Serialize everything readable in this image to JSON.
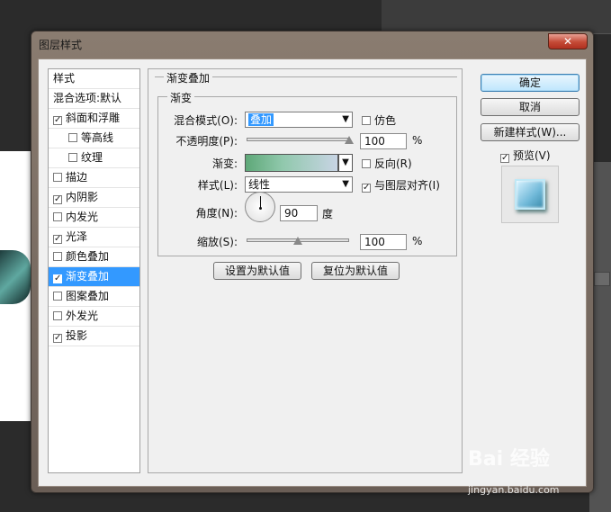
{
  "window": {
    "title": "图层样式",
    "close_symbol": "✕"
  },
  "style_list": {
    "items": [
      {
        "label": "样式",
        "checkbox": false,
        "checked": false,
        "indent": false,
        "selected": false
      },
      {
        "label": "混合选项:默认",
        "checkbox": false,
        "checked": false,
        "indent": false,
        "selected": false
      },
      {
        "label": "斜面和浮雕",
        "checkbox": true,
        "checked": true,
        "indent": false,
        "selected": false
      },
      {
        "label": "等高线",
        "checkbox": true,
        "checked": false,
        "indent": true,
        "selected": false
      },
      {
        "label": "纹理",
        "checkbox": true,
        "checked": false,
        "indent": true,
        "selected": false
      },
      {
        "label": "描边",
        "checkbox": true,
        "checked": false,
        "indent": false,
        "selected": false
      },
      {
        "label": "内阴影",
        "checkbox": true,
        "checked": true,
        "indent": false,
        "selected": false
      },
      {
        "label": "内发光",
        "checkbox": true,
        "checked": false,
        "indent": false,
        "selected": false
      },
      {
        "label": "光泽",
        "checkbox": true,
        "checked": true,
        "indent": false,
        "selected": false
      },
      {
        "label": "颜色叠加",
        "checkbox": true,
        "checked": false,
        "indent": false,
        "selected": false
      },
      {
        "label": "渐变叠加",
        "checkbox": true,
        "checked": true,
        "indent": false,
        "selected": true
      },
      {
        "label": "图案叠加",
        "checkbox": true,
        "checked": false,
        "indent": false,
        "selected": false
      },
      {
        "label": "外发光",
        "checkbox": true,
        "checked": false,
        "indent": false,
        "selected": false
      },
      {
        "label": "投影",
        "checkbox": true,
        "checked": true,
        "indent": false,
        "selected": false
      }
    ]
  },
  "panel": {
    "section_title": "渐变叠加",
    "group_title": "渐变",
    "blend_mode_label": "混合模式(O):",
    "blend_mode_value": "叠加",
    "dither_label": "仿色",
    "dither_checked": false,
    "opacity_label": "不透明度(P):",
    "opacity_value": "100",
    "opacity_percent": 100,
    "opacity_unit": "%",
    "gradient_label": "渐变:",
    "reverse_label": "反向(R)",
    "reverse_checked": false,
    "style_label": "样式(L):",
    "style_value": "线性",
    "align_label": "与图层对齐(I)",
    "align_checked": true,
    "angle_label": "角度(N):",
    "angle_value": "90",
    "angle_unit": "度",
    "scale_label": "缩放(S):",
    "scale_value": "100",
    "scale_percent": 100,
    "scale_unit": "%",
    "make_default_button": "设置为默认值",
    "reset_default_button": "复位为默认值"
  },
  "actions": {
    "ok_button": "确定",
    "cancel_button": "取消",
    "new_style_button": "新建样式(W)...",
    "preview_label": "预览(V)",
    "preview_checked": true
  },
  "watermark": {
    "text": "Bai 经验",
    "url": "jingyan.baidu.com"
  },
  "colors": {
    "selection": "#3399ff",
    "gradient_start": "#5ea878",
    "gradient_end": "#c8d4e4"
  }
}
